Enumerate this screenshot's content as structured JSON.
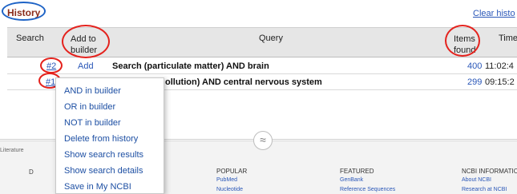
{
  "history": {
    "title": "History",
    "clear_link": "Clear histo"
  },
  "table": {
    "headers": {
      "search": "Search",
      "add_line1": "Add to",
      "add_line2": "builder",
      "query": "Query",
      "items_line1": "Items",
      "items_line2": "found",
      "time": "Time"
    },
    "rows": [
      {
        "num": "#2",
        "add": "Add",
        "query": "Search (particulate matter) AND brain",
        "count": "400",
        "time": "11:02:4"
      },
      {
        "num": "#1",
        "add": "",
        "query": "ollution) AND central nervous system",
        "count": "299",
        "time": "09:15:2"
      }
    ]
  },
  "context_menu": {
    "items": [
      "AND in builder",
      "OR in builder",
      "NOT in builder",
      "Delete from history",
      "Show search results",
      "Show search details",
      "Save in My NCBI"
    ]
  },
  "footer": {
    "lit_label": "Literature",
    "d_label": "D",
    "collapse_icon": "≈",
    "columns": [
      {
        "heading": "POPULAR",
        "items": [
          "PubMed",
          "Nucleotide"
        ]
      },
      {
        "heading": "FEATURED",
        "items": [
          "GenBank",
          "Reference Sequences"
        ]
      },
      {
        "heading": "NCBI INFORMATIC",
        "items": [
          "About NCBI",
          "Research at NCBI"
        ]
      }
    ]
  },
  "colors": {
    "annotation_red": "#e4221d",
    "annotation_blue": "#1e63c6",
    "link": "#2a57b8",
    "title": "#8a2b1a"
  }
}
